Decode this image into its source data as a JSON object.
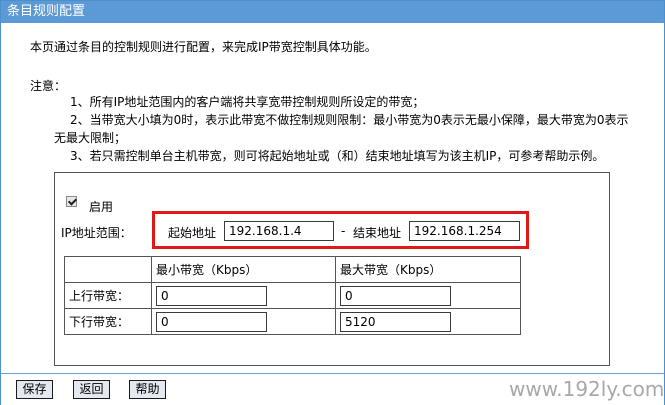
{
  "title": "条目规则配置",
  "intro": "本页通过条目的控制规则进行配置，来完成IP带宽控制具体功能。",
  "notes": {
    "heading": "注意：",
    "items": [
      "1、所有IP地址范围内的客户端将共享宽带控制规则所设定的带宽；",
      "2、当带宽大小填为0时，表示此带宽不做控制规则限制：最小带宽为0表示无最小保障，最大带宽为0表示",
      "无最大限制；",
      "3、若只需控制单台主机带宽，则可将起始地址或（和）结束地址填写为该主机IP，可参考帮助示例。"
    ]
  },
  "form": {
    "enable_label": "启用",
    "enable_checked": true,
    "ip_range_label": "IP地址范围：",
    "start_label": "起始地址",
    "start_value": "192.168.1.4",
    "dash": "-",
    "end_label": "结束地址",
    "end_value": "192.168.1.254"
  },
  "bandwidth": {
    "min_header": "最小带宽（Kbps）",
    "max_header": "最大带宽（Kbps）",
    "upload_label": "上行带宽：",
    "upload_min": "0",
    "upload_max": "0",
    "download_label": "下行带宽：",
    "download_min": "0",
    "download_max": "5120"
  },
  "buttons": {
    "save": "保存",
    "back": "返回",
    "help": "帮助"
  },
  "watermark": "www.192ly.com",
  "colors": {
    "titlebar": "#5b9ad5",
    "highlight": "#e01818"
  }
}
